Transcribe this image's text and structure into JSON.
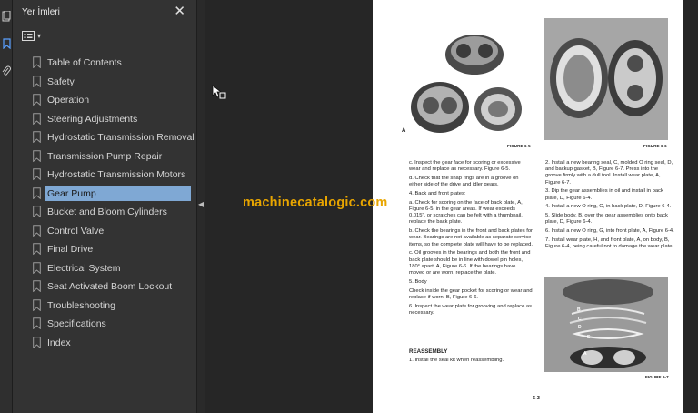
{
  "panel": {
    "title": "Yer İmleri",
    "close_glyph": "✕"
  },
  "bookmarks": [
    {
      "label": "Table of Contents"
    },
    {
      "label": "Safety"
    },
    {
      "label": "Operation"
    },
    {
      "label": "Steering Adjustments"
    },
    {
      "label": "Hydrostatic Transmission Removal"
    },
    {
      "label": "Transmission Pump Repair"
    },
    {
      "label": "Hydrostatic Transmission Motors"
    },
    {
      "label": "Gear Pump"
    },
    {
      "label": "Bucket  and Bloom Cylinders"
    },
    {
      "label": "Control Valve"
    },
    {
      "label": "Final Drive"
    },
    {
      "label": "Electrical System"
    },
    {
      "label": "Seat Activated Boom Lockout"
    },
    {
      "label": "Troubleshooting"
    },
    {
      "label": "Specifications"
    },
    {
      "label": "Index"
    }
  ],
  "selected_bookmark": "Gear Pump",
  "page": {
    "fig5_caption": "FIGURE 6-5",
    "fig6_caption": "FIGURE 6-6",
    "fig7_caption": "FIGURE 6-7",
    "fig_letters": [
      "A",
      "B",
      "C",
      "D",
      "E",
      "G",
      "H"
    ],
    "left_col": [
      "c. Inspect the gear face for scoring or excessive wear and replace as necessary. Figure 6-5.",
      "d. Check that the snap rings are in a groove on either side of the drive and idler gears.",
      "4. Back and front plates:",
      "a. Check for scoring on the face of back plate, A, Figure 6-5, in the gear areas. If wear exceeds 0.015\", or scratches can be felt with a thumbnail, replace the back plate.",
      "b. Check the bearings in the front and back plates for wear. Bearings are not available as separate service items, so the complete plate will have to be replaced.",
      "c. Oil grooves in the bearings and both the front and back plate should be in line with dowel pin holes, 180° apart, A, Figure 6-6. If the bearings have moved or are worn, replace the plate.",
      "5. Body",
      "Check inside the gear pocket for scoring or wear and replace if worn, B, Figure 6-6.",
      "6. Inspect the wear plate for grooving and replace as necessary."
    ],
    "reassembly_heading": "REASSEMBLY",
    "reassembly_first": "1. Install the seal kit when reassembling.",
    "right_col": [
      "2. Install a new bearing seal, C, molded O ring seal, D, and backup gasket, B, Figure 6-7. Press into the groove firmly with a dull tool. Install wear plate, A, Figure 6-7.",
      "3. Dip the gear assemblies in oil and install in back plate, D, Figure 6-4.",
      "4. Install a new O ring, G, in back plate, D, Figure 6-4.",
      "5. Slide body, B, over the gear assemblies onto back plate, D, Figure 6-4.",
      "6. Install a new O ring, G, into front plate, A, Figure 6-4.",
      "7. Install wear plate, H, and front plate, A, on body, B, Figure 6-4, being careful not to damage the wear plate."
    ],
    "page_number": "6-3"
  },
  "watermark": "machinecatalogic.com",
  "icons": [
    "pages-icon",
    "bookmark-panel-icon",
    "attachment-icon",
    "options-menu-icon",
    "bookmark-icon",
    "collapse-arrow-icon",
    "cursor-icon"
  ],
  "colors": {
    "panel_bg": "#333333",
    "selection": "#7fa8d4",
    "watermark": "#e8a500",
    "accent": "#5aa0ff"
  }
}
